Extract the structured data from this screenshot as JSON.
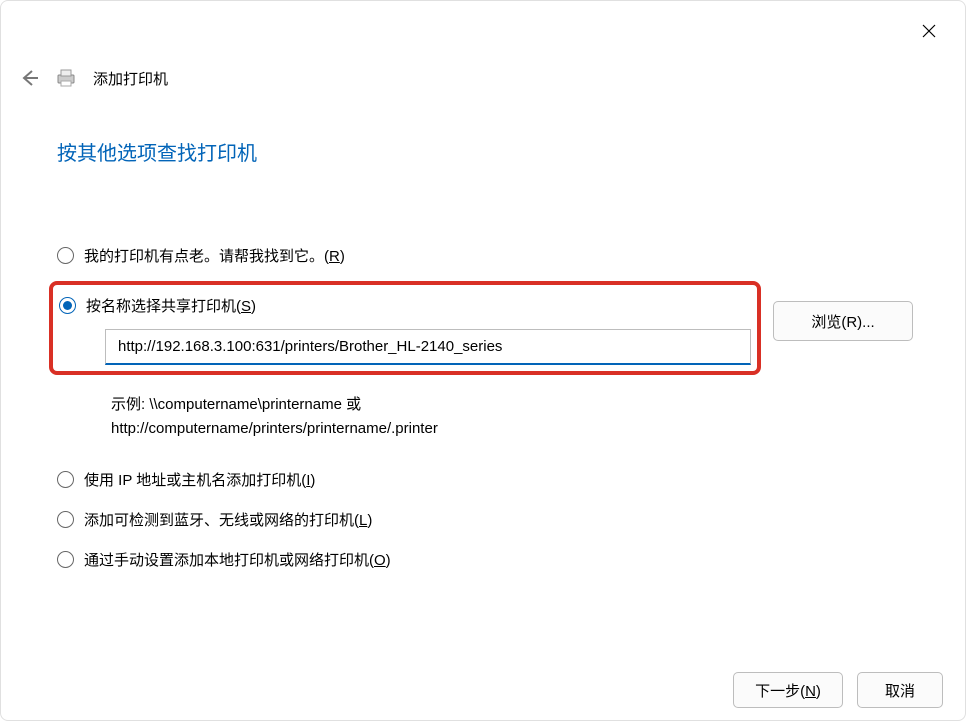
{
  "window": {
    "title": "添加打印机"
  },
  "heading": "按其他选项查找打印机",
  "options": {
    "opt0": {
      "label_pre": "我的打印机有点老。请帮我找到它。(",
      "akey": "R",
      "label_post": ")"
    },
    "opt1": {
      "label_pre": "按名称选择共享打印机(",
      "akey": "S",
      "label_post": ")"
    },
    "opt2": {
      "label_pre": "使用 IP 地址或主机名添加打印机(",
      "akey": "I",
      "label_post": ")"
    },
    "opt3": {
      "label_pre": "添加可检测到蓝牙、无线或网络的打印机(",
      "akey": "L",
      "label_post": ")"
    },
    "opt4": {
      "label_pre": "通过手动设置添加本地打印机或网络打印机(",
      "akey": "O",
      "label_post": ")"
    }
  },
  "share_input": {
    "value": "http://192.168.3.100:631/printers/Brother_HL-2140_series"
  },
  "browse": {
    "label_pre": "浏览(",
    "akey": "R",
    "label_post": ")..."
  },
  "example": {
    "line1": "示例: \\\\computername\\printername 或",
    "line2": "http://computername/printers/printername/.printer"
  },
  "footer": {
    "next": {
      "label_pre": "下一步(",
      "akey": "N",
      "label_post": ")"
    },
    "cancel": {
      "label": "取消"
    }
  }
}
